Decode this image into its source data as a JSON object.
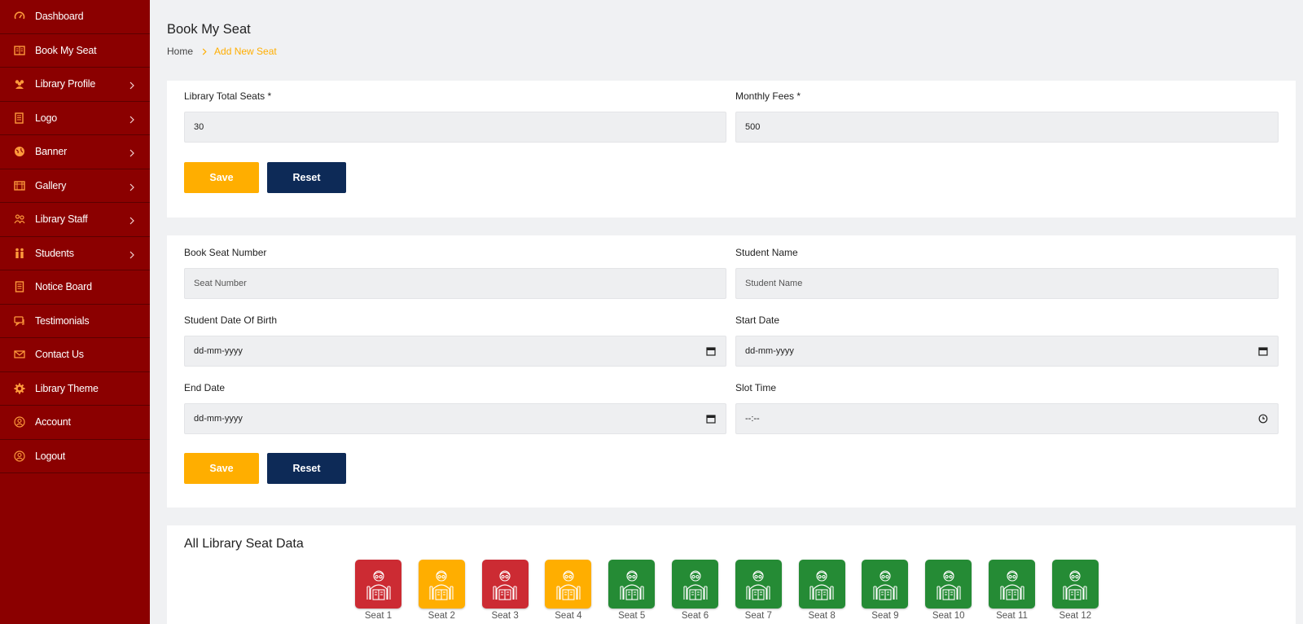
{
  "sidebar": {
    "items": [
      {
        "label": "Dashboard",
        "icon": "speedometer-icon",
        "chevron": false
      },
      {
        "label": "Book My Seat",
        "icon": "book-icon",
        "chevron": false
      },
      {
        "label": "Library Profile",
        "icon": "users-icon",
        "chevron": true
      },
      {
        "label": "Logo",
        "icon": "document-icon",
        "chevron": true
      },
      {
        "label": "Banner",
        "icon": "globe-icon",
        "chevron": true
      },
      {
        "label": "Gallery",
        "icon": "gallery-icon",
        "chevron": true
      },
      {
        "label": "Library Staff",
        "icon": "staff-icon",
        "chevron": true
      },
      {
        "label": "Students",
        "icon": "students-icon",
        "chevron": true
      },
      {
        "label": "Notice Board",
        "icon": "notice-icon",
        "chevron": false
      },
      {
        "label": "Testimonials",
        "icon": "chat-icon",
        "chevron": false
      },
      {
        "label": "Contact Us",
        "icon": "mail-icon",
        "chevron": false
      },
      {
        "label": "Library Theme",
        "icon": "gear-icon",
        "chevron": false
      },
      {
        "label": "Account",
        "icon": "user-circle-icon",
        "chevron": false
      },
      {
        "label": "Logout",
        "icon": "logout-icon",
        "chevron": false
      }
    ]
  },
  "header": {
    "title": "Book My Seat",
    "breadcrumb": {
      "home": "Home",
      "current": "Add New Seat"
    }
  },
  "settings_form": {
    "total_seats_label": "Library Total Seats *",
    "total_seats_value": "30",
    "monthly_fees_label": "Monthly Fees *",
    "monthly_fees_value": "500",
    "save_label": "Save",
    "reset_label": "Reset"
  },
  "booking_form": {
    "seat_number_label": "Book Seat Number",
    "seat_number_placeholder": "Seat Number",
    "student_name_label": "Student Name",
    "student_name_placeholder": "Student Name",
    "dob_label": "Student Date Of Birth",
    "dob_value": "dd-mm-yyyy",
    "start_date_label": "Start Date",
    "start_date_value": "dd-mm-yyyy",
    "end_date_label": "End Date",
    "end_date_value": "dd-mm-yyyy",
    "slot_time_label": "Slot Time",
    "slot_time_value": "--:--",
    "save_label": "Save",
    "reset_label": "Reset"
  },
  "seat_data": {
    "title": "All Library Seat Data",
    "status_colors": {
      "booked": "#cc2b33",
      "partial": "#ffae00",
      "available": "#258b35"
    },
    "seats": [
      {
        "label": "Seat 1",
        "status": "booked"
      },
      {
        "label": "Seat 2",
        "status": "partial"
      },
      {
        "label": "Seat 3",
        "status": "booked"
      },
      {
        "label": "Seat 4",
        "status": "partial"
      },
      {
        "label": "Seat 5",
        "status": "available"
      },
      {
        "label": "Seat 6",
        "status": "available"
      },
      {
        "label": "Seat 7",
        "status": "available"
      },
      {
        "label": "Seat 8",
        "status": "available"
      },
      {
        "label": "Seat 9",
        "status": "available"
      },
      {
        "label": "Seat 10",
        "status": "available"
      },
      {
        "label": "Seat 11",
        "status": "available"
      },
      {
        "label": "Seat 12",
        "status": "available"
      }
    ]
  }
}
